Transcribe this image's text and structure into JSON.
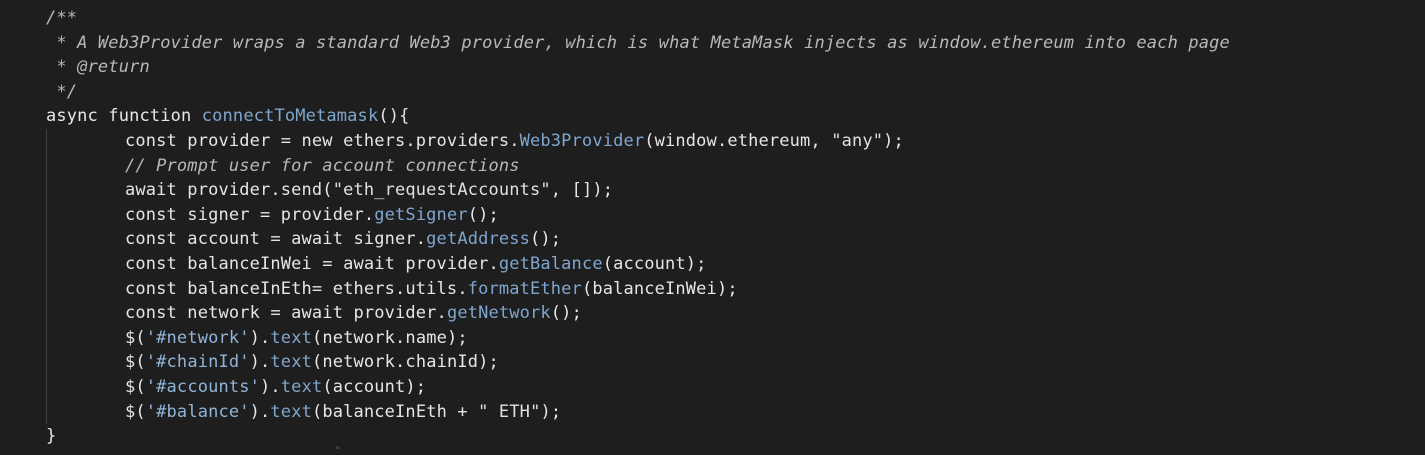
{
  "editor": {
    "theme_background": "#1e1e1e",
    "lines": [
      {
        "indent": false,
        "tokens": [
          {
            "t": "/**",
            "c": "cm"
          }
        ]
      },
      {
        "indent": false,
        "tokens": [
          {
            "t": " * A Web3Provider wraps a standard Web3 provider, which is what MetaMask injects as window.ethereum into each page",
            "c": "cm"
          }
        ]
      },
      {
        "indent": false,
        "tokens": [
          {
            "t": " * @return",
            "c": "cm"
          }
        ]
      },
      {
        "indent": false,
        "tokens": [
          {
            "t": " */",
            "c": "cm"
          }
        ]
      },
      {
        "indent": false,
        "tokens": [
          {
            "t": "async function ",
            "c": "kw"
          },
          {
            "t": "connectToMetamask",
            "c": "fn"
          },
          {
            "t": "(){",
            "c": "pl"
          }
        ]
      },
      {
        "indent": true,
        "tokens": [
          {
            "t": "const provider = new ethers.providers.",
            "c": "pl"
          },
          {
            "t": "Web3Provider",
            "c": "fn"
          },
          {
            "t": "(window.ethereum, ",
            "c": "pl"
          },
          {
            "t": "\"any\"",
            "c": "str"
          },
          {
            "t": ");",
            "c": "pl"
          }
        ]
      },
      {
        "indent": true,
        "tokens": [
          {
            "t": "// Prompt user for account connections",
            "c": "cm"
          }
        ]
      },
      {
        "indent": true,
        "tokens": [
          {
            "t": "await provider.send(",
            "c": "pl"
          },
          {
            "t": "\"eth_requestAccounts\"",
            "c": "str"
          },
          {
            "t": ", []);",
            "c": "pl"
          }
        ]
      },
      {
        "indent": true,
        "tokens": [
          {
            "t": "const signer = provider.",
            "c": "pl"
          },
          {
            "t": "getSigner",
            "c": "fn"
          },
          {
            "t": "();",
            "c": "pl"
          }
        ]
      },
      {
        "indent": true,
        "tokens": [
          {
            "t": "const account = await signer.",
            "c": "pl"
          },
          {
            "t": "getAddress",
            "c": "fn"
          },
          {
            "t": "();",
            "c": "pl"
          }
        ]
      },
      {
        "indent": true,
        "tokens": [
          {
            "t": "const balanceInWei = await provider.",
            "c": "pl"
          },
          {
            "t": "getBalance",
            "c": "fn"
          },
          {
            "t": "(account);",
            "c": "pl"
          }
        ]
      },
      {
        "indent": true,
        "tokens": [
          {
            "t": "const balanceInEth= ethers.utils.",
            "c": "pl"
          },
          {
            "t": "formatEther",
            "c": "fn"
          },
          {
            "t": "(balanceInWei);",
            "c": "pl"
          }
        ]
      },
      {
        "indent": true,
        "tokens": [
          {
            "t": "const network = await provider.",
            "c": "pl"
          },
          {
            "t": "getNetwork",
            "c": "fn"
          },
          {
            "t": "();",
            "c": "pl"
          }
        ]
      },
      {
        "indent": true,
        "tokens": [
          {
            "t": "$(",
            "c": "pl"
          },
          {
            "t": "'#network'",
            "c": "sel"
          },
          {
            "t": ").",
            "c": "pl"
          },
          {
            "t": "text",
            "c": "fn"
          },
          {
            "t": "(network.name);",
            "c": "pl"
          }
        ]
      },
      {
        "indent": true,
        "tokens": [
          {
            "t": "$(",
            "c": "pl"
          },
          {
            "t": "'#chainId'",
            "c": "sel"
          },
          {
            "t": ").",
            "c": "pl"
          },
          {
            "t": "text",
            "c": "fn"
          },
          {
            "t": "(network.chainId);",
            "c": "pl"
          }
        ]
      },
      {
        "indent": true,
        "tokens": [
          {
            "t": "$(",
            "c": "pl"
          },
          {
            "t": "'#accounts'",
            "c": "sel"
          },
          {
            "t": ").",
            "c": "pl"
          },
          {
            "t": "text",
            "c": "fn"
          },
          {
            "t": "(account);",
            "c": "pl"
          }
        ]
      },
      {
        "indent": true,
        "tokens": [
          {
            "t": "$(",
            "c": "pl"
          },
          {
            "t": "'#balance'",
            "c": "sel"
          },
          {
            "t": ").",
            "c": "pl"
          },
          {
            "t": "text",
            "c": "fn"
          },
          {
            "t": "(balanceInEth + ",
            "c": "pl"
          },
          {
            "t": "\" ETH\"",
            "c": "str"
          },
          {
            "t": ");",
            "c": "pl"
          }
        ]
      },
      {
        "indent": false,
        "tokens": [
          {
            "t": "}",
            "c": "pl"
          }
        ]
      }
    ]
  }
}
